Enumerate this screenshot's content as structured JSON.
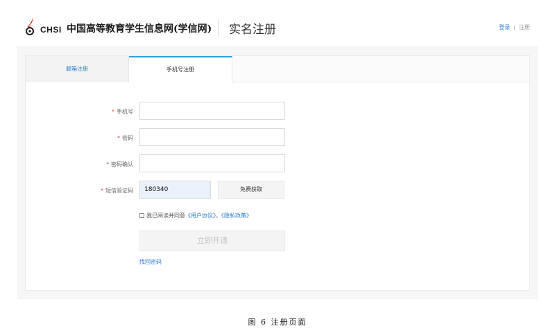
{
  "header": {
    "logo_text": "CHSI",
    "site_name": "中国高等教育学生信息网(学信网)",
    "page_title": "实名注册",
    "login_link": "登录",
    "separator": "|",
    "register_link": "注册"
  },
  "tabs": [
    {
      "label": "邮箱注册",
      "active": false
    },
    {
      "label": "手机号注册",
      "active": true
    }
  ],
  "form": {
    "required_mark": "*",
    "phone_label": "手机号",
    "phone_value": "",
    "password_label": "密码",
    "password_value": "",
    "confirm_label": "密码确认",
    "confirm_value": "",
    "sms_label": "短信验证码",
    "sms_value": "180340",
    "sms_button": "免费获取",
    "agree_text": "我已阅读并同意",
    "agree_link_user": "《用户协议》",
    "agree_sep": "、",
    "agree_link_privacy": "《隐私政策》",
    "submit_label": "立即开通",
    "forgot_link": "找回密码"
  },
  "caption": "图 6 注册页面",
  "colors": {
    "accent": "#2b7bd0",
    "tab_active_border": "#2fa0d8",
    "required": "#e64b3c",
    "logo_red": "#d72a20"
  }
}
